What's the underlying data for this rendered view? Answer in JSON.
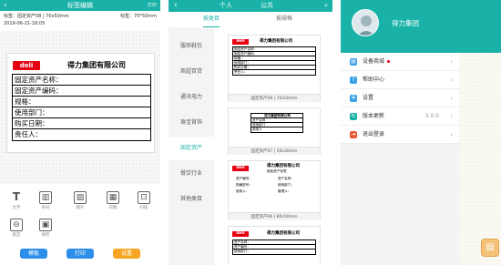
{
  "screen1": {
    "header": {
      "title": "标签编辑",
      "action": "打印"
    },
    "info": {
      "line1": "标签：固定资产08 | 70x50mm",
      "line2": "2019-06-21-18:05",
      "size": "标签：70*50mm"
    },
    "label": {
      "logo": "deli",
      "company": "得力集团有限公司",
      "rows": [
        "固定资产名称：",
        "固定资产编码：",
        "规格：",
        "使用部门：",
        "购买日期：",
        "责任人："
      ]
    },
    "tools": [
      {
        "icon": "text-icon",
        "label": "文字",
        "glyph": "T"
      },
      {
        "icon": "barcode-icon",
        "label": "条码",
        "glyph": "▥"
      },
      {
        "icon": "image-icon",
        "label": "图片",
        "glyph": "▨"
      },
      {
        "icon": "date-icon",
        "label": "日期",
        "glyph": "▦"
      },
      {
        "icon": "scan-icon",
        "label": "扫描",
        "glyph": "⊡"
      },
      {
        "icon": "lock-icon",
        "label": "锁定",
        "glyph": "⊖"
      },
      {
        "icon": "save-icon",
        "label": "保存",
        "glyph": "▣"
      }
    ],
    "buttons": [
      {
        "label": "模板",
        "color": "#2c8ee8"
      },
      {
        "label": "打印",
        "color": "#2c8ee8"
      },
      {
        "label": "设置",
        "color": "#f6a623"
      }
    ]
  },
  "screen2": {
    "header": {
      "tab1": "个人",
      "tab2": "公共"
    },
    "tabs": [
      "按类目",
      "按规格"
    ],
    "categories": [
      "服饰鞋包",
      "商超百货",
      "通讯电力",
      "珠宝首饰",
      "固定资产",
      "餐饮行业",
      "其他类目"
    ],
    "active_category": "固定资产",
    "templates": [
      {
        "caption": "固定资产08 | 70x50mm",
        "logo": "deli",
        "company": "得力集团有限公司",
        "rows": [
          "固定资产名称：",
          "固定资产编码：",
          "规格：",
          "使用部门：",
          "购买日期：",
          "责任人："
        ]
      },
      {
        "caption": "固定资产07 | 50x30mm",
        "company": "得力集团有限公司",
        "rows": [
          "资产名称",
          "使用部门",
          "使用人"
        ]
      },
      {
        "caption": "固定资产06 | 80x50mm",
        "logo": "deli",
        "company": "得力集团有限公司",
        "subtitle": "固定资产标签",
        "lines": [
          "资产编号：",
          "资产名称：",
          "规格型号：",
          "使用部门：",
          "使用人：",
          "管理人："
        ]
      },
      {
        "caption": "",
        "logo": "deli",
        "company": "得力集团有限公司",
        "lines": [
          "资产名称：",
          "资产编号：",
          "使用部门："
        ]
      }
    ]
  },
  "screen3": {
    "profile": {
      "name": "得力集团"
    },
    "menu": [
      {
        "icon": "store-icon",
        "label": "设备商城",
        "color": "#3aa0e8",
        "glyph": "▤",
        "badge": true,
        "value": ""
      },
      {
        "icon": "help-icon",
        "label": "帮助中心",
        "color": "#3aa0e8",
        "glyph": "?",
        "badge": false,
        "value": ""
      },
      {
        "icon": "gear-icon",
        "label": "设置",
        "color": "#3aa0e8",
        "glyph": "✲",
        "badge": false,
        "value": ""
      },
      {
        "icon": "update-icon",
        "label": "版本更新",
        "color": "#1ab2a8",
        "glyph": "↻",
        "badge": false,
        "value": "3.0.0"
      },
      {
        "icon": "logout-icon",
        "label": "退出登录",
        "color": "#e85a3a",
        "glyph": "⇥",
        "badge": false,
        "value": ""
      }
    ]
  }
}
